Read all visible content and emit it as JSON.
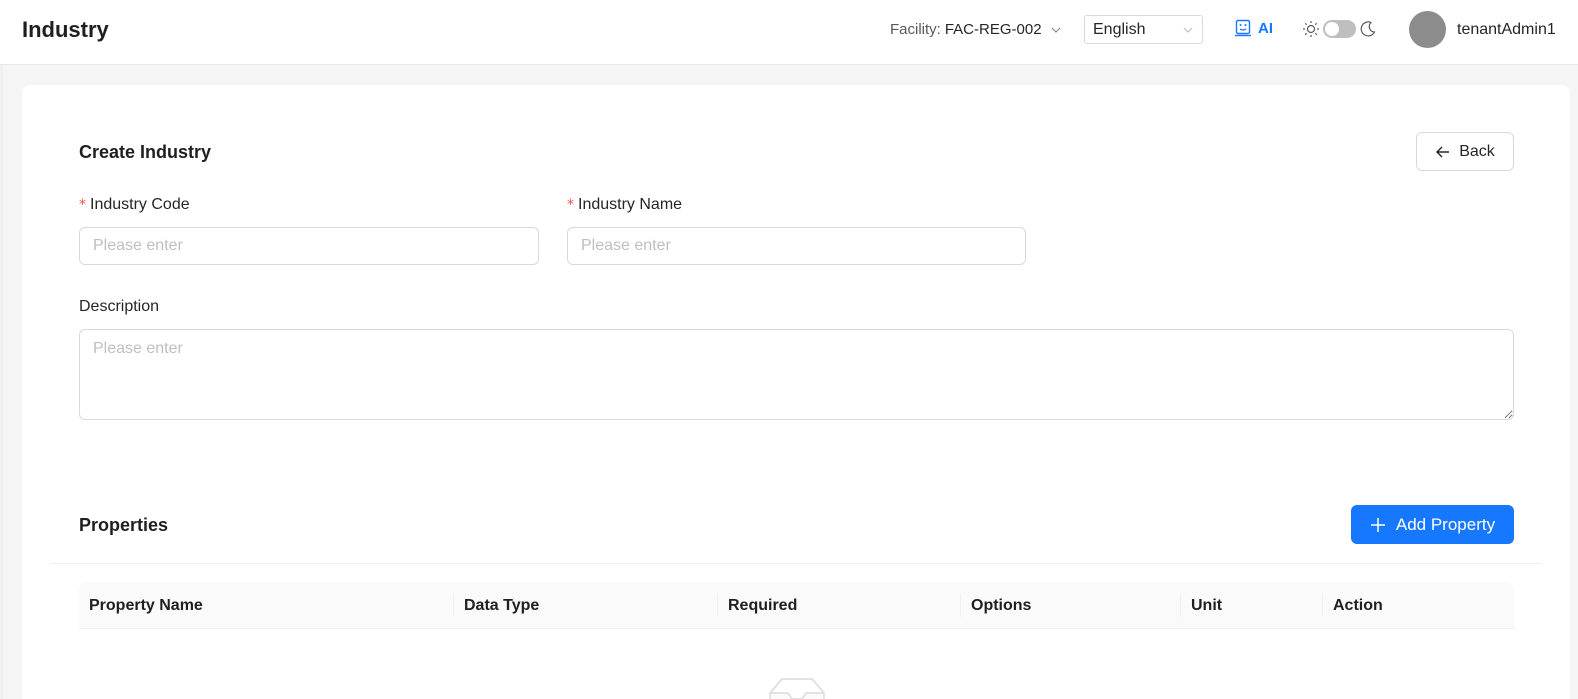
{
  "header": {
    "title": "Industry",
    "facility_label": "Facility:",
    "facility_value": "FAC-REG-002",
    "language": "English",
    "ai_label": "AI",
    "theme_toggle_dark": false,
    "username": "tenantAdmin1"
  },
  "form": {
    "title": "Create Industry",
    "back_label": "Back",
    "industry_code": {
      "label": "Industry Code",
      "required": true,
      "value": "",
      "placeholder": "Please enter"
    },
    "industry_name": {
      "label": "Industry Name",
      "required": true,
      "value": "",
      "placeholder": "Please enter"
    },
    "description": {
      "label": "Description",
      "value": "",
      "placeholder": "Please enter"
    }
  },
  "properties": {
    "title": "Properties",
    "add_label": "Add Property",
    "columns": [
      "Property Name",
      "Data Type",
      "Required",
      "Options",
      "Unit",
      "Action"
    ],
    "rows": []
  },
  "colors": {
    "accent": "#1677ff",
    "required_mark": "#ff4d4f"
  }
}
